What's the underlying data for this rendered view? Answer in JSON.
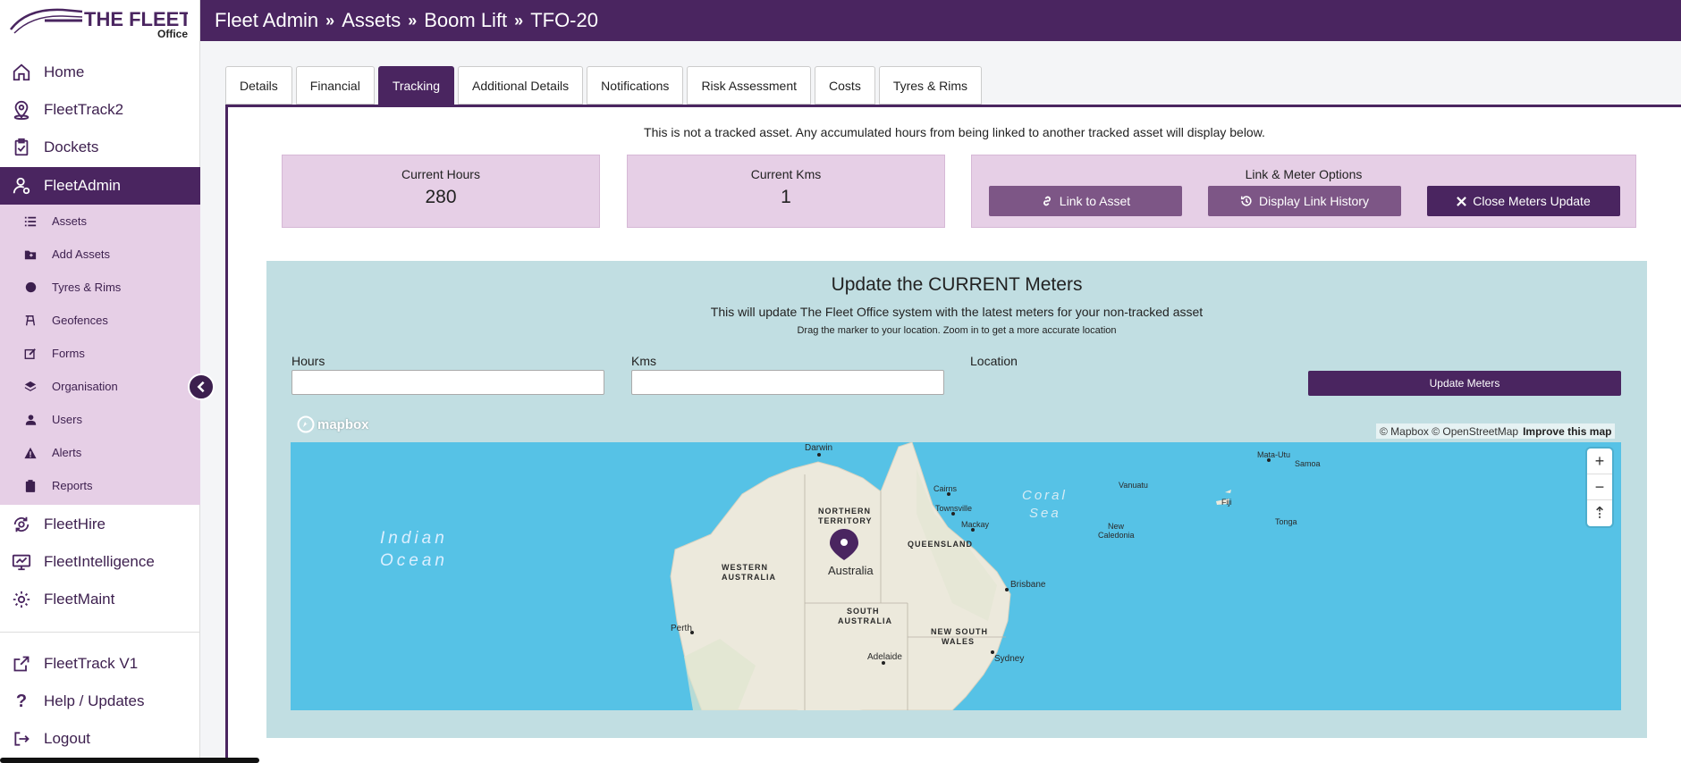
{
  "brand": {
    "name": "THE FLEET",
    "sub": "Office"
  },
  "breadcrumb": [
    "Fleet Admin",
    "Assets",
    "Boom Lift",
    "TFO-20"
  ],
  "sidebar": {
    "main": [
      {
        "label": "Home",
        "icon": "home-icon"
      },
      {
        "label": "FleetTrack2",
        "icon": "map-pin-icon"
      },
      {
        "label": "Dockets",
        "icon": "clipboard-check-icon"
      },
      {
        "label": "FleetAdmin",
        "icon": "user-admin-icon"
      }
    ],
    "sub": [
      {
        "label": "Assets",
        "icon": "list-icon"
      },
      {
        "label": "Add Assets",
        "icon": "folder-plus-icon"
      },
      {
        "label": "Tyres & Rims",
        "icon": "circle-icon"
      },
      {
        "label": "Geofences",
        "icon": "geofence-icon"
      },
      {
        "label": "Forms",
        "icon": "edit-icon"
      },
      {
        "label": "Organisation",
        "icon": "layers-icon"
      },
      {
        "label": "Users",
        "icon": "user-icon"
      },
      {
        "label": "Alerts",
        "icon": "warning-icon"
      },
      {
        "label": "Reports",
        "icon": "clipboard-icon"
      }
    ],
    "more": [
      {
        "label": "FleetHire",
        "icon": "fleethire-icon"
      },
      {
        "label": "FleetIntelligence",
        "icon": "monitor-icon"
      },
      {
        "label": "FleetMaint",
        "icon": "gear-icon"
      }
    ],
    "bottom": [
      {
        "label": "FleetTrack V1",
        "icon": "external-link-icon"
      },
      {
        "label": "Help / Updates",
        "icon": "question-icon"
      },
      {
        "label": "Logout",
        "icon": "logout-icon"
      }
    ]
  },
  "tabs": [
    {
      "label": "Details",
      "active": false
    },
    {
      "label": "Financial",
      "active": false
    },
    {
      "label": "Tracking",
      "active": true
    },
    {
      "label": "Additional Details",
      "active": false
    },
    {
      "label": "Notifications",
      "active": false
    },
    {
      "label": "Risk Assessment",
      "active": false
    },
    {
      "label": "Costs",
      "active": false
    },
    {
      "label": "Tyres & Rims",
      "active": false
    }
  ],
  "tracking": {
    "notice": "This is not a tracked asset. Any accumulated hours from being linked to another tracked asset will display below.",
    "current_hours": {
      "label": "Current Hours",
      "value": "280"
    },
    "current_kms": {
      "label": "Current Kms",
      "value": "1"
    },
    "options": {
      "title": "Link & Meter Options",
      "link_btn": "Link to Asset",
      "history_btn": "Display Link History",
      "close_btn": "Close Meters Update"
    }
  },
  "update": {
    "title": "Update the CURRENT Meters",
    "subtitle": "This will update The Fleet Office system with the latest meters for your non-tracked asset",
    "hint": "Drag the marker to your location. Zoom in to get a more accurate location",
    "hours_label": "Hours",
    "hours_value": "",
    "kms_label": "Kms",
    "kms_value": "",
    "location_label": "Location",
    "button": "Update Meters"
  },
  "map": {
    "logo": "mapbox",
    "attribution": "© Mapbox © OpenStreetMap",
    "improve": "Improve this map",
    "labels": {
      "indian": "Indian",
      "ocean": "Ocean",
      "coral": "Coral",
      "sea": "Sea",
      "darwin": "Darwin",
      "nt1": "NORTHERN",
      "nt2": "TERRITORY",
      "qld": "QUEENSLAND",
      "wa1": "WESTERN",
      "wa2": "AUSTRALIA",
      "australia": "Australia",
      "sa1": "SOUTH",
      "sa2": "AUSTRALIA",
      "nsw1": "NEW SOUTH",
      "nsw2": "WALES",
      "cairns": "Cairns",
      "townsville": "Townsville",
      "mackay": "Mackay",
      "brisbane": "Brisbane",
      "perth": "Perth",
      "adelaide": "Adelaide",
      "sydney": "Sydney",
      "vanuatu": "Vanuatu",
      "newcal1": "New",
      "newcal2": "Caledonia",
      "fiji": "Fiji",
      "tonga": "Tonga",
      "mataUtu": "Mata-Utu",
      "samoa": "Samoa"
    },
    "zoom_in": "+",
    "zoom_out": "−",
    "compass": "⇡"
  },
  "colors": {
    "brand": "#4a2560",
    "submenu": "#e6cfe6",
    "water": "#56c2e6",
    "land": "#ece9dc"
  }
}
